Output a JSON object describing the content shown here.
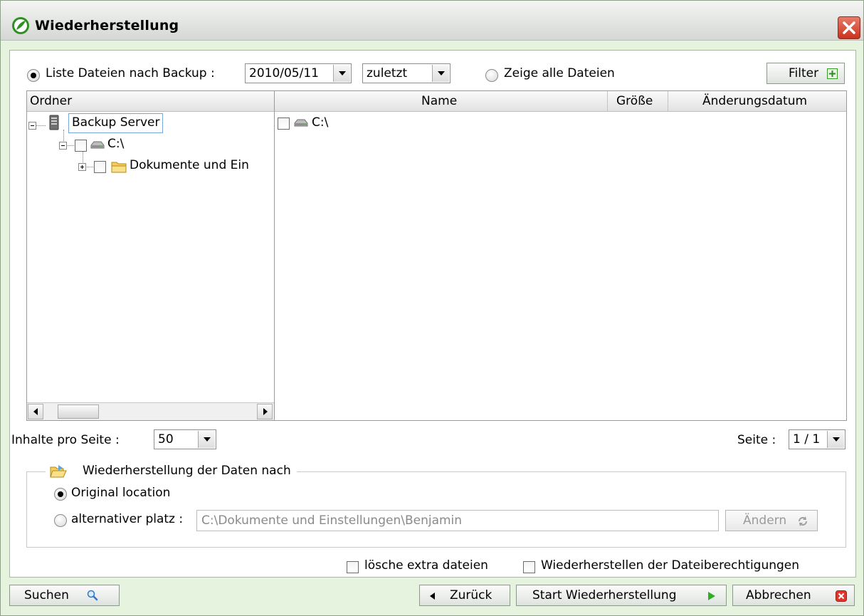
{
  "window": {
    "title": "Wiederherstellung"
  },
  "top_bar": {
    "radio_list_label": "Liste Dateien nach Backup :",
    "date_select_value": "2010/05/11",
    "version_select_value": "zuletzt",
    "radio_all_label": "Zeige alle Dateien",
    "filter_label": "Filter"
  },
  "folder_tree": {
    "header": "Ordner",
    "nodes": [
      {
        "label": "Backup Server",
        "icon": "server-icon"
      },
      {
        "label": "C:\\",
        "icon": "drive-icon"
      },
      {
        "label": "Dokumente und Ein",
        "icon": "folder-icon"
      }
    ]
  },
  "file_list": {
    "columns": [
      "Name",
      "Größe",
      "Änderungsdatum"
    ],
    "rows": [
      {
        "name": "C:\\",
        "icon": "drive-icon",
        "size": "",
        "modified": ""
      }
    ]
  },
  "pagination": {
    "per_page_label": "Inhalte pro Seite :",
    "per_page_value": "50",
    "page_label": "Seite :",
    "page_value": "1 / 1"
  },
  "restore_target": {
    "group_label": "Wiederherstellung der Daten nach",
    "original_label": "Original location",
    "alternative_label": "alternativer platz :",
    "alternative_path": "C:\\Dokumente und Einstellungen\\Benjamin",
    "change_label": "Ändern"
  },
  "options": {
    "delete_extra_label": "lösche extra dateien",
    "restore_permissions_label": "Wiederherstellen der Dateiberechtigungen"
  },
  "footer": {
    "search_label": "Suchen",
    "back_label": "Zurück",
    "start_label": "Start Wiederherstellung",
    "cancel_label": "Abbrechen"
  },
  "colors": {
    "window_bg": "#e6f4df",
    "accent_green": "#3a9a2a",
    "close_red": "#c9331f"
  }
}
